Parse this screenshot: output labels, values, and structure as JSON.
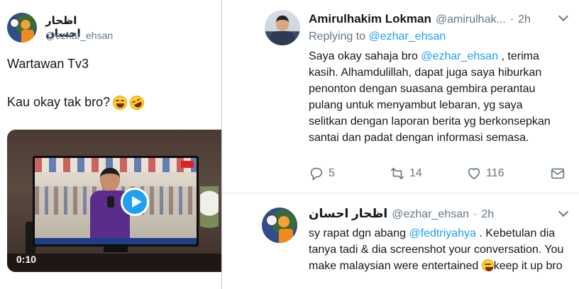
{
  "left_tweet": {
    "author_name": "اظحار احسان",
    "author_handle": "@ezhar_ehsan",
    "line1": "Wartawan Tv3",
    "line2": "Kau okay tak bro?",
    "emojis": [
      "grinning-squinting-face",
      "rolling-on-floor-laughing"
    ],
    "video_time": "0:10"
  },
  "reply1": {
    "author_name": "Amirulhakim Lokman",
    "author_handle": "@amirulhak...",
    "dot": "·",
    "time": "2h",
    "replying_prefix": "Replying to",
    "replying_to": "@ezhar_ehsan",
    "text_before_mention": "Saya okay sahaja bro ",
    "mention": "@ezhar_ehsan",
    "text_after_mention": " , terima kasih. Alhamdulillah, dapat juga saya hiburkan penonton dengan suasana gembira perantau pulang untuk menyambut lebaran, yg saya selitkan dengan laporan berita yg berkonsepkan santai dan padat dengan informasi semasa.",
    "reply_count": "5",
    "retweet_count": "14",
    "like_count": "116"
  },
  "reply2": {
    "author_name": "اظحار احسان",
    "author_handle": "@ezhar_ehsan",
    "dot": "·",
    "time": "2h",
    "text_before_mention": "sy rapat dgn abang ",
    "mention": "@fedtriyahya",
    "text_after_mention": " . Kebetulan dia tanya tadi & dia screenshot your conversation. You make malaysian were entertained ",
    "text_end": "keep it up bro",
    "emoji": "smiling-face-with-smiling-eyes"
  },
  "colors": {
    "link": "#1da1f2",
    "muted": "#657786",
    "text": "#14171a"
  }
}
